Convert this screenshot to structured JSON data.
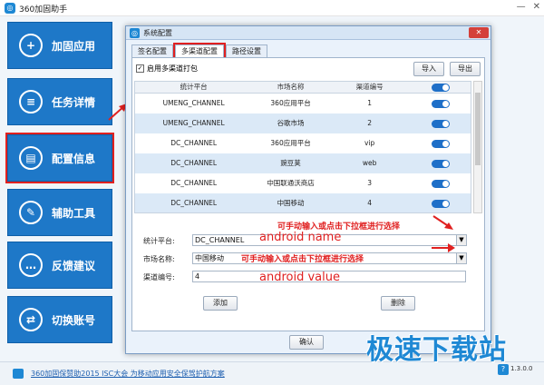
{
  "app": {
    "title": "360加固助手"
  },
  "nav": {
    "items": [
      {
        "label": "加固应用",
        "icon": "shield-plus-icon",
        "glyph": "+"
      },
      {
        "label": "任务详情",
        "icon": "document-list-icon",
        "glyph": "≡"
      },
      {
        "label": "配置信息",
        "icon": "clipboard-icon",
        "glyph": "▤"
      },
      {
        "label": "辅助工具",
        "icon": "wrench-icon",
        "glyph": "✎"
      },
      {
        "label": "反馈建议",
        "icon": "chat-bubble-icon",
        "glyph": "…"
      },
      {
        "label": "切换账号",
        "icon": "switch-account-icon",
        "glyph": "⇄"
      }
    ],
    "active_index": 2
  },
  "dialog": {
    "title": "系统配置",
    "tabs": [
      "签名配置",
      "多渠道配置",
      "路径设置"
    ],
    "selected_tab": 1,
    "enable_label": "启用多渠道打包",
    "import_label": "导入",
    "export_label": "导出",
    "table": {
      "headers": [
        "统计平台",
        "市场名称",
        "渠道编号",
        ""
      ],
      "rows": [
        {
          "platform": "UMENG_CHANNEL",
          "market": "360应用平台",
          "channel": "1"
        },
        {
          "platform": "UMENG_CHANNEL",
          "market": "谷歌市场",
          "channel": "2"
        },
        {
          "platform": "DC_CHANNEL",
          "market": "360应用平台",
          "channel": "vip"
        },
        {
          "platform": "DC_CHANNEL",
          "market": "豌豆荚",
          "channel": "web"
        },
        {
          "platform": "DC_CHANNEL",
          "market": "中国联通沃商店",
          "channel": "3"
        },
        {
          "platform": "DC_CHANNEL",
          "market": "中国移动",
          "channel": "4"
        }
      ]
    },
    "form": {
      "platform_label": "统计平台:",
      "platform_value": "DC_CHANNEL",
      "market_label": "市场名称:",
      "market_value": "中国移动",
      "channel_label": "渠道编号:",
      "channel_value": "4"
    },
    "add_label": "添加",
    "delete_label": "删除",
    "ok_label": "确认"
  },
  "annotations": {
    "hint_top": "可手动输入或点击下拉框进行选择",
    "name": "android name",
    "hint_mid": "可手动输入或点击下拉框进行选择",
    "value": "android value",
    "color": "#e02020"
  },
  "status": {
    "link": "360加固保赞助2015 ISC大会 为移动应用安全保驾护航方案",
    "version": "1.3.0.0"
  },
  "watermark": "极速下载站"
}
